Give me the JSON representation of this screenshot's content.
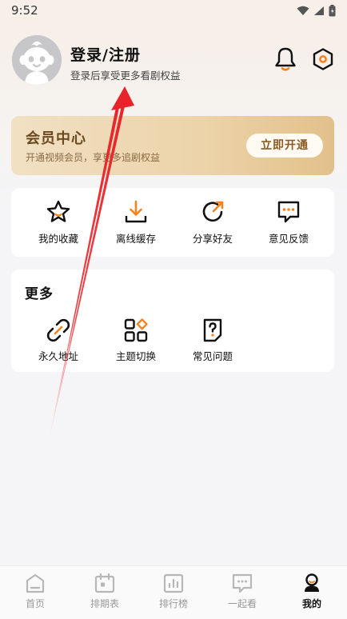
{
  "status_bar": {
    "time": "9:52"
  },
  "profile": {
    "login_label": "登录/注册",
    "subtitle": "登录后享受更多看剧权益"
  },
  "vip": {
    "title": "会员中心",
    "subtitle": "开通视频会员，享更多追剧权益",
    "button_label": "立即开通"
  },
  "quick_actions": [
    {
      "label": "我的收藏",
      "icon": "star-icon"
    },
    {
      "label": "离线缓存",
      "icon": "download-icon"
    },
    {
      "label": "分享好友",
      "icon": "share-icon"
    },
    {
      "label": "意见反馈",
      "icon": "feedback-icon"
    }
  ],
  "more": {
    "title": "更多",
    "items": [
      {
        "label": "永久地址",
        "icon": "link-icon"
      },
      {
        "label": "主题切换",
        "icon": "theme-icon"
      },
      {
        "label": "常见问题",
        "icon": "question-icon"
      }
    ]
  },
  "tab_bar": {
    "items": [
      {
        "label": "首页",
        "icon": "home-icon",
        "active": false
      },
      {
        "label": "排期表",
        "icon": "calendar-icon",
        "active": false
      },
      {
        "label": "排行榜",
        "icon": "ranking-icon",
        "active": false
      },
      {
        "label": "一起看",
        "icon": "watch-together-icon",
        "active": false
      },
      {
        "label": "我的",
        "icon": "profile-icon",
        "active": true
      }
    ]
  },
  "colors": {
    "accent": "#f5831f",
    "vip_gold": "#e3c08a",
    "annotation_arrow": "#e8232a"
  }
}
